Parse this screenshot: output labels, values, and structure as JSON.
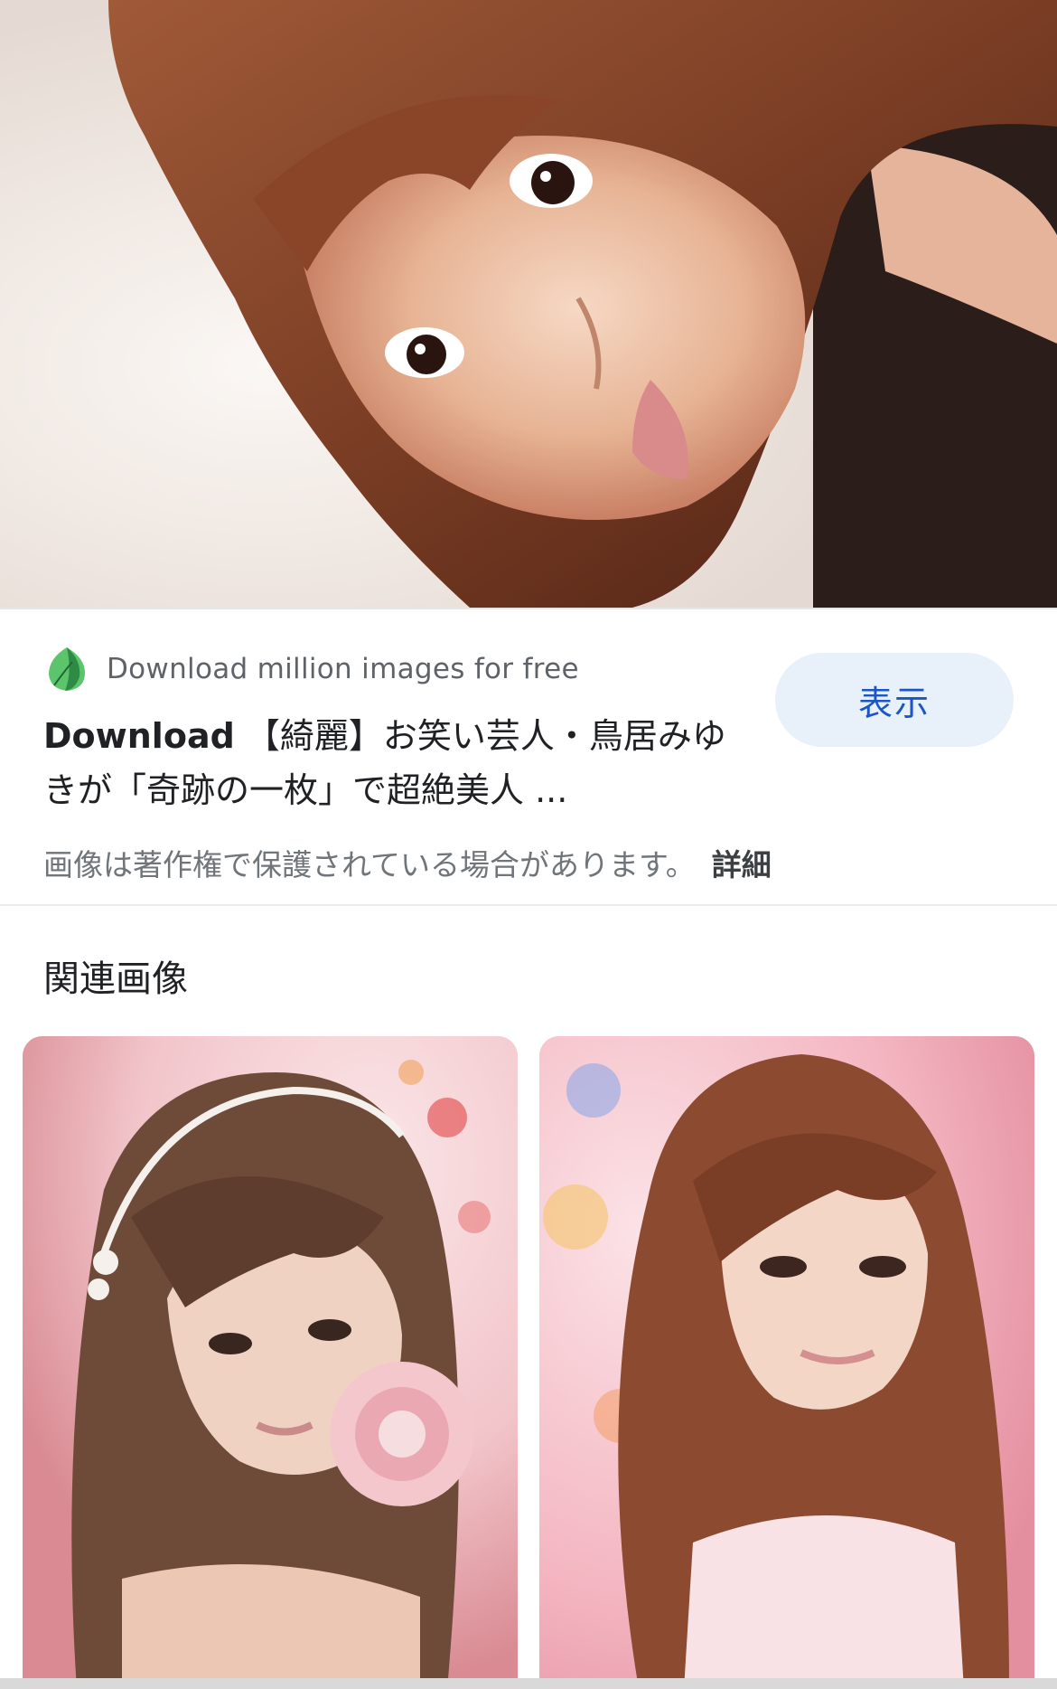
{
  "source": {
    "name": "Download million images for free",
    "icon": "leaf-icon"
  },
  "result": {
    "title_lead": "Download",
    "title_rest": " 【綺麗】お笑い芸人・鳥居みゆきが「奇跡の一枚」で超絶美人 ..."
  },
  "view_button": {
    "label": "表示"
  },
  "copyright": {
    "text": "画像は著作権で保護されている場合があります。",
    "details_label": "詳細"
  },
  "related": {
    "heading": "関連画像",
    "items": [
      {
        "name": "related-image-1"
      },
      {
        "name": "related-image-2"
      }
    ]
  },
  "colors": {
    "button_bg": "#e8f0fa",
    "button_text": "#1a56c4",
    "muted_text": "#5f6368",
    "leaf_green": "#34a853"
  }
}
